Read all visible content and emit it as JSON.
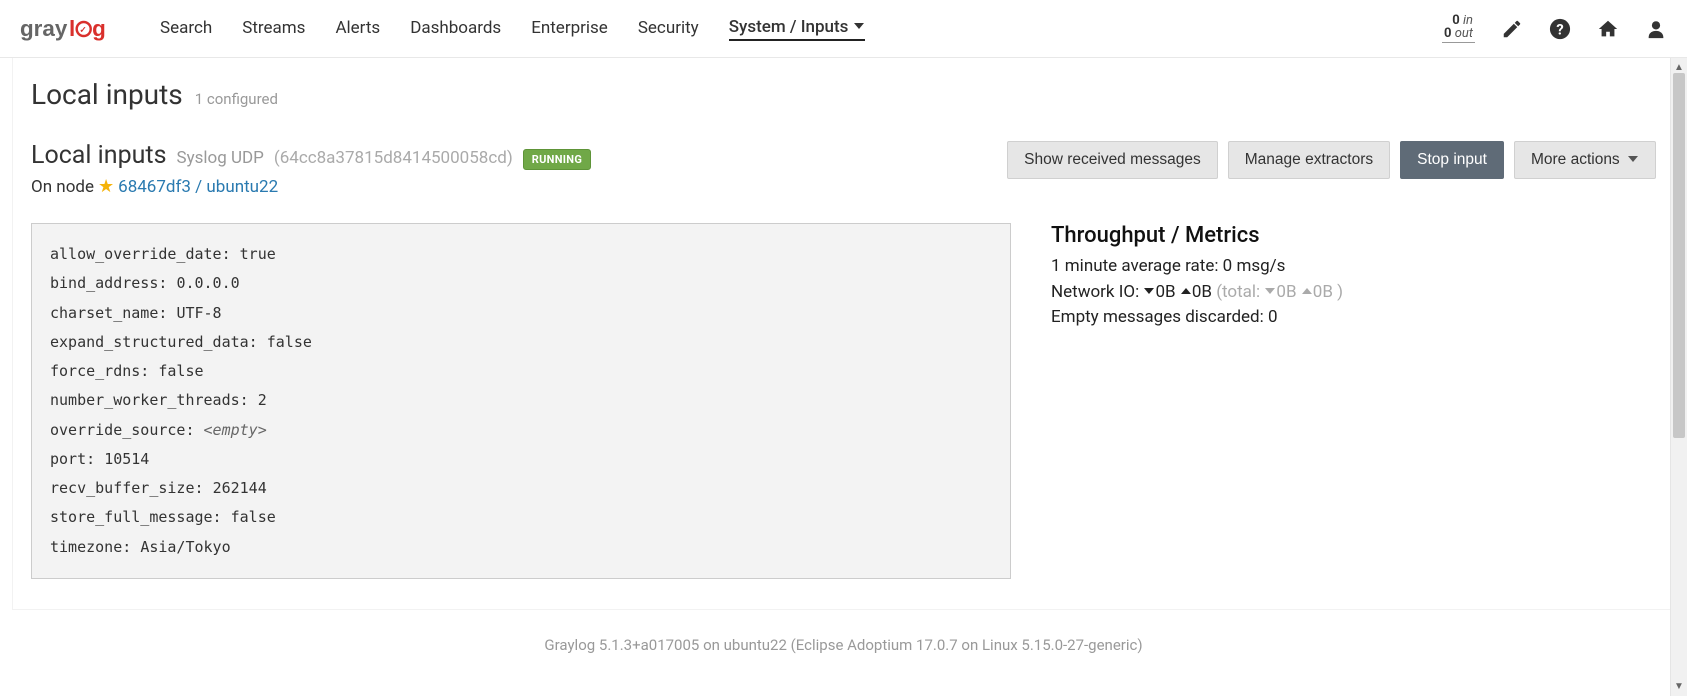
{
  "nav": {
    "items": [
      {
        "label": "Search"
      },
      {
        "label": "Streams"
      },
      {
        "label": "Alerts"
      },
      {
        "label": "Dashboards"
      },
      {
        "label": "Enterprise"
      },
      {
        "label": "Security"
      },
      {
        "label": "System / Inputs"
      }
    ],
    "throughput": {
      "in_count": "0",
      "in_label": "in",
      "out_count": "0",
      "out_label": "out"
    }
  },
  "page": {
    "title": "Local inputs",
    "subtitle": "1 configured"
  },
  "input": {
    "name": "Local inputs",
    "type": "Syslog UDP",
    "id": "(64cc8a37815d8414500058cd)",
    "running_badge": "RUNNING",
    "on_node_prefix": "On node",
    "node_link": "68467df3 / ubuntu22",
    "buttons": {
      "show": "Show received messages",
      "manage": "Manage extractors",
      "stop": "Stop input",
      "more": "More actions"
    },
    "config": {
      "allow_override_date": "true",
      "bind_address": "0.0.0.0",
      "charset_name": "UTF-8",
      "expand_structured_data": "false",
      "force_rdns": "false",
      "number_worker_threads": "2",
      "override_source": "<empty>",
      "port": "10514",
      "recv_buffer_size": "262144",
      "store_full_message": "false",
      "timezone": "Asia/Tokyo"
    }
  },
  "metrics": {
    "heading": "Throughput / Metrics",
    "avg_rate_label": "1 minute average rate:",
    "avg_rate_value": "0 msg/s",
    "network_label": "Network IO:",
    "net_down": "0B",
    "net_up": "0B",
    "total_label": "(total:",
    "total_down": "0B",
    "total_up": "0B",
    "total_close": ")",
    "empty_label": "Empty messages discarded:",
    "empty_value": "0"
  },
  "footer": "Graylog 5.1.3+a017005 on ubuntu22 (Eclipse Adoptium 17.0.7 on Linux 5.15.0-27-generic)"
}
